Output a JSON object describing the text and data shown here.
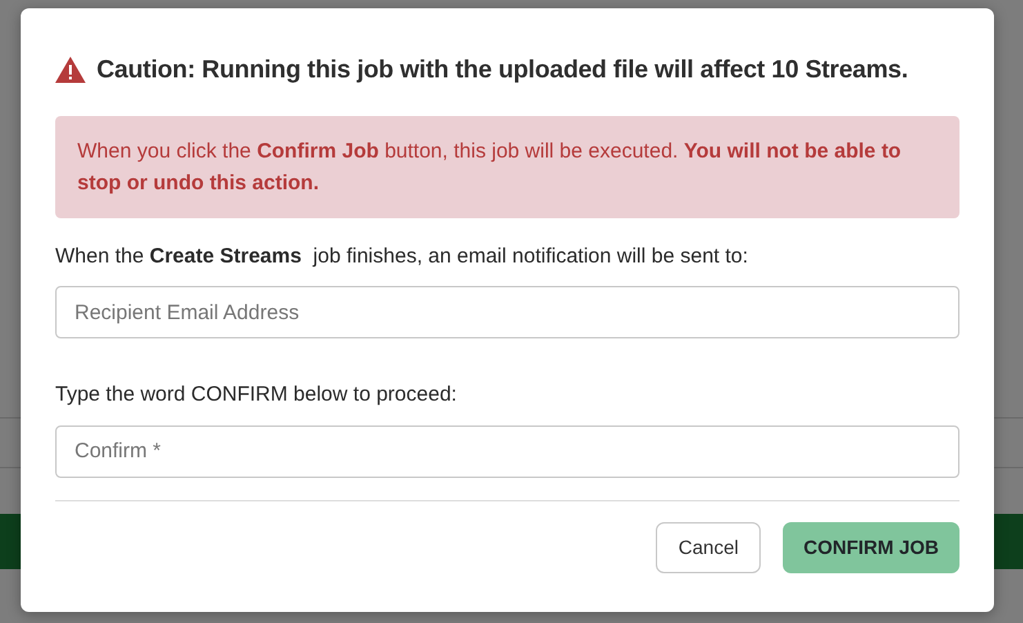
{
  "dialog": {
    "title": "Caution: Running this job with the uploaded file will affect 10 Streams.",
    "alert": "When you click the **Confirm Job** button, this job will be executed. **You will not be able to stop or undo this action.**",
    "email_label": "When the **Create Streams**  job finishes, an email notification will be sent to:",
    "email_field": {
      "placeholder": "Recipient Email Address"
    },
    "confirm_label": "Type the word CONFIRM below to proceed:",
    "confirm_field": {
      "placeholder": "Confirm *"
    },
    "buttons": [
      {
        "label": "Cancel",
        "kind": "secondary",
        "disabled": false
      },
      {
        "label": "CONFIRM JOB",
        "kind": "primary",
        "disabled": true
      }
    ]
  }
}
